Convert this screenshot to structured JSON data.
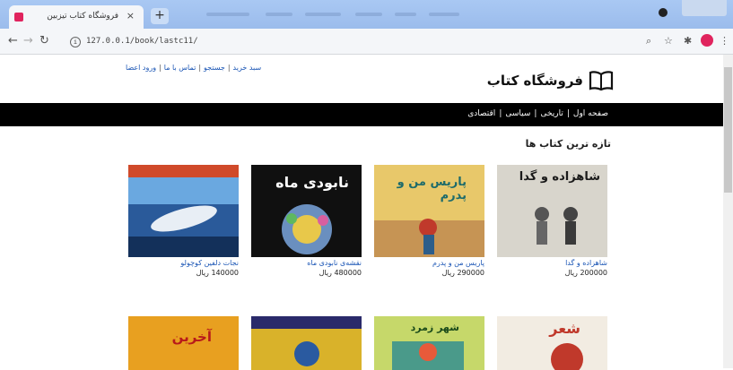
{
  "browser": {
    "tab_title": "فروشگاه کتاب تیزبین",
    "tab_close": "×",
    "new_tab": "+",
    "url": "127.0.0.1/book/lastc11/"
  },
  "site": {
    "top_links": [
      "سبد خرید",
      "جستجو",
      "تماس با ما",
      "ورود اعضا"
    ],
    "top_links_sep": "|",
    "title": "فروشگاه کتاب",
    "nav": [
      "صفحه اول",
      "تاریخی",
      "سیاسی",
      "اقتصادی"
    ],
    "nav_sep": "|",
    "section_title": "تازه ترین کتاب ها"
  },
  "books": [
    {
      "name": "شاهزاده و گدا",
      "price": "200000",
      "currency": "ریال",
      "cover_text": "شاهزاده و گدا",
      "cover_color": "#d8d5cc",
      "text_color": "#1a1a1a"
    },
    {
      "name": "پاریس من و پدرم",
      "price": "290000",
      "currency": "ریال",
      "cover_text": "پاریس من و پدرم",
      "cover_color": "#e8c86a",
      "text_color": "#1d6b6b"
    },
    {
      "name": "نقشه‌ی نابودی ماه",
      "price": "480000",
      "currency": "ریال",
      "cover_text": "نابودی ماه",
      "cover_color": "#101010",
      "text_color": "#ffffff"
    },
    {
      "name": "نجات دلفین کوچولو",
      "price": "140000",
      "currency": "ریال",
      "cover_text": "",
      "cover_color": "#2a5a9a",
      "text_color": "#ffffff"
    }
  ],
  "books_row2": [
    {
      "cover_text": "شعر",
      "cover_color": "#f2ece2",
      "text_color": "#c0392b"
    },
    {
      "cover_text": "شهر زمرد",
      "cover_color": "#c6d86a",
      "text_color": "#1a4a1a"
    },
    {
      "cover_text": "",
      "cover_color": "#d9b22a",
      "text_color": "#333"
    },
    {
      "cover_text": "آخرین",
      "cover_color": "#e8a020",
      "text_color": "#b81a1a"
    }
  ]
}
